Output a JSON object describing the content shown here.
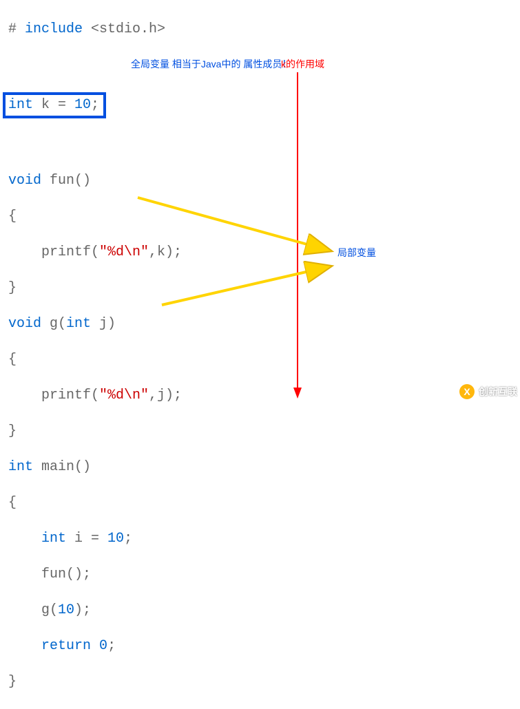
{
  "code": {
    "l1a": "# ",
    "l1b": "include",
    "l1c": " <stdio.h>",
    "blank": "",
    "l3_int": "int",
    "l3_rest": " k = ",
    "l3_num": "10",
    "l3_semi": ";",
    "l5_void": "void",
    "l5_rest": " fun()",
    "lbrace": "{",
    "rbrace": "}",
    "l7a": "    printf(",
    "l7s": "\"%d\\n\"",
    "l7b": ",k);",
    "l9_void": "void",
    "l9_rest": " g(",
    "l9_int": "int",
    "l9_j": " j)",
    "l11a": "    printf(",
    "l11s": "\"%d\\n\"",
    "l11b": ",j);",
    "l13_int": "int",
    "l13_rest": " main()",
    "l15a": "    ",
    "l15_int": "int",
    "l15b": " i = ",
    "l15_num": "10",
    "l15c": ";",
    "l16": "    fun();",
    "l17": "    g(",
    "l17_num": "10",
    "l17b": ");",
    "l18a": "    ",
    "l18_ret": "return",
    "l18b": " ",
    "l18_num": "0",
    "l18c": ";"
  },
  "annotations": {
    "global_var": "全局变量 相当于Java中的\n属性成员！",
    "k_scope": "k的作用域",
    "local_var": "局部变量"
  },
  "watermark": {
    "logo": "X",
    "text": "创新互联"
  }
}
